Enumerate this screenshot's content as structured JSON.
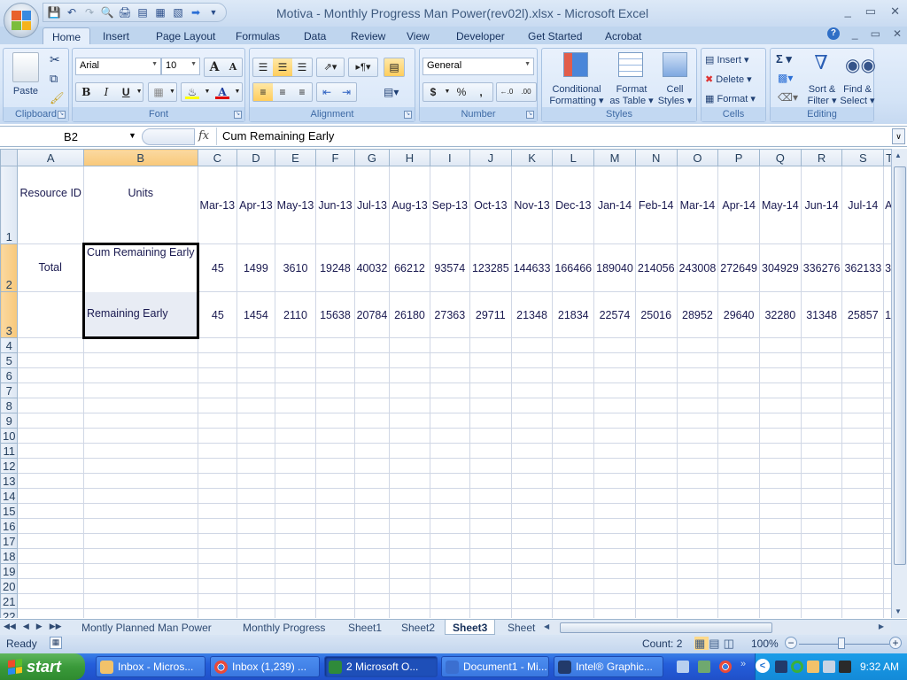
{
  "window": {
    "title": "Motiva - Monthly Progress  Man Power(rev02l).xlsx - Microsoft Excel",
    "controls": [
      "_",
      "▭",
      "✕"
    ]
  },
  "qat": {
    "icons": [
      "save-icon",
      "undo-icon",
      "redo-icon",
      "print-preview-icon",
      "quick-print-icon",
      "form-icon",
      "grid-icon",
      "view-icon",
      "arrow-icon",
      "customize-icon"
    ]
  },
  "ribbon_tabs": [
    "Home",
    "Insert",
    "Page Layout",
    "Formulas",
    "Data",
    "Review",
    "View",
    "Developer",
    "Get Started",
    "Acrobat"
  ],
  "active_tab": "Home",
  "ribbon": {
    "clipboard": {
      "label": "Clipboard",
      "paste": "Paste"
    },
    "font": {
      "label": "Font",
      "font_name": "Arial",
      "font_size": "10",
      "bold": "B",
      "italic": "I",
      "underline": "U",
      "grow": "A",
      "shrink": "A",
      "fill_color": "#ffff00",
      "font_color": "#e00000"
    },
    "alignment": {
      "label": "Alignment"
    },
    "number": {
      "label": "Number",
      "format": "General",
      "currency": "$",
      "percent": "%",
      "comma": ",",
      "inc_decimal": "←.0 .00",
      "dec_decimal": ".00 →.0"
    },
    "styles": {
      "label": "Styles",
      "conditional": "Conditional",
      "conditional2": "Formatting ▾",
      "format_table": "Format",
      "format_table2": "as Table ▾",
      "cell_styles": "Cell",
      "cell_styles2": "Styles ▾"
    },
    "cells": {
      "label": "Cells",
      "insert": "Insert ▾",
      "delete": "Delete ▾",
      "format": "Format ▾"
    },
    "editing": {
      "label": "Editing",
      "sum": "Σ ▾",
      "sort": "Sort &",
      "sort2": "Filter ▾",
      "find": "Find &",
      "find2": "Select ▾"
    }
  },
  "formula_bar": {
    "name_box": "B2",
    "fx": "fx",
    "formula": "Cum Remaining Early"
  },
  "sheet": {
    "columns": [
      "A",
      "B",
      "C",
      "D",
      "E",
      "F",
      "G",
      "H",
      "I",
      "J",
      "K",
      "L",
      "M",
      "N",
      "O",
      "P",
      "Q",
      "R",
      "S",
      "T"
    ],
    "selected_column": "B",
    "rows": [
      {
        "num": "1",
        "a": "Resource ID",
        "b": "Units",
        "values": [
          "Mar-13",
          "Apr-13",
          "May-13",
          "Jun-13",
          "Jul-13",
          "Aug-13",
          "Sep-13",
          "Oct-13",
          "Nov-13",
          "Dec-13",
          "Jan-14",
          "Feb-14",
          "Mar-14",
          "Apr-14",
          "May-14",
          "Jun-14",
          "Jul-14",
          "A"
        ]
      },
      {
        "num": "2",
        "a": "Total",
        "b": "Cum Remaining Early",
        "values": [
          "45",
          "1499",
          "3610",
          "19248",
          "40032",
          "66212",
          "93574",
          "123285",
          "144633",
          "166466",
          "189040",
          "214056",
          "243008",
          "272649",
          "304929",
          "336276",
          "362133",
          "3"
        ]
      },
      {
        "num": "3",
        "a": "",
        "b": "Remaining Early",
        "values": [
          "45",
          "1454",
          "2110",
          "15638",
          "20784",
          "26180",
          "27363",
          "29711",
          "21348",
          "21834",
          "22574",
          "25016",
          "28952",
          "29640",
          "32280",
          "31348",
          "25857",
          "1"
        ]
      }
    ],
    "empty_rows": [
      "4",
      "5",
      "6",
      "7",
      "8",
      "9",
      "10",
      "11",
      "12",
      "13",
      "14",
      "15",
      "16",
      "17",
      "18",
      "19",
      "20",
      "21",
      "22"
    ]
  },
  "sheet_tabs": [
    "Montly Planned Man Power",
    "Monthly Progress",
    "Sheet1",
    "Sheet2",
    "Sheet3",
    "Sheet"
  ],
  "active_sheet": "Sheet3",
  "status": {
    "ready": "Ready",
    "count": "Count: 2",
    "zoom": "100%"
  },
  "taskbar": {
    "start": "start",
    "items": [
      "Inbox - Micros...",
      "Inbox (1,239) ...",
      "2 Microsoft O...",
      "Document1 - Mi...",
      "Intel® Graphic..."
    ],
    "clock": "9:32 AM"
  }
}
